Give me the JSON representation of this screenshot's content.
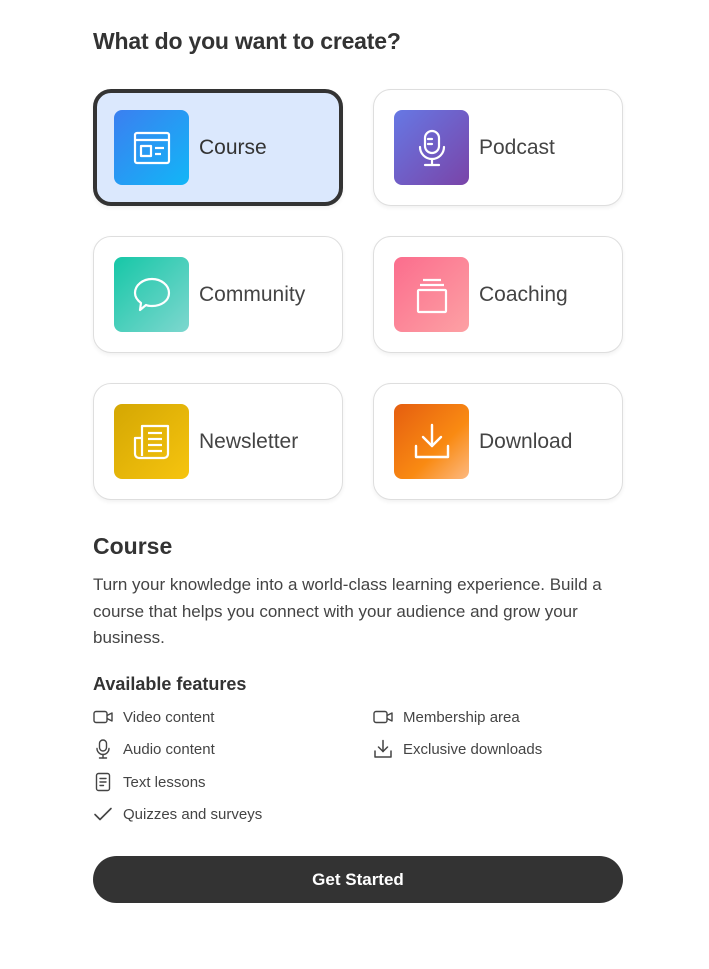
{
  "header": {
    "title": "What do you want to create?"
  },
  "options": [
    {
      "label": "Course",
      "icon": "course-icon",
      "selected": true
    },
    {
      "label": "Podcast",
      "icon": "microphone-icon",
      "selected": false
    },
    {
      "label": "Community",
      "icon": "chat-bubble-icon",
      "selected": false
    },
    {
      "label": "Coaching",
      "icon": "coaching-stack-icon",
      "selected": false
    },
    {
      "label": "Newsletter",
      "icon": "newspaper-icon",
      "selected": false
    },
    {
      "label": "Download",
      "icon": "download-icon",
      "selected": false
    }
  ],
  "detail": {
    "title": "Course",
    "description": "Turn your knowledge into a world-class learning experience. Build a course that helps you connect with your audience and grow your business.",
    "features_title": "Available features",
    "features": [
      {
        "label": "Video content",
        "icon": "video-icon"
      },
      {
        "label": "Audio content",
        "icon": "microphone-icon"
      },
      {
        "label": "Text lessons",
        "icon": "document-icon"
      },
      {
        "label": "Quizzes and surveys",
        "icon": "checkmark-icon"
      },
      {
        "label": "Membership area",
        "icon": "video-icon"
      },
      {
        "label": "Exclusive downloads",
        "icon": "download-icon"
      }
    ]
  },
  "cta": {
    "label": "Get Started"
  },
  "colors": {
    "selected_bg": "#dbe8fd",
    "dark": "#333333",
    "course": "#3b7ff0",
    "podcast": "#7a44a8",
    "community": "#16c7a7",
    "coaching": "#fb6d8d",
    "newsletter": "#f6c40f",
    "download": "#f98a12"
  }
}
